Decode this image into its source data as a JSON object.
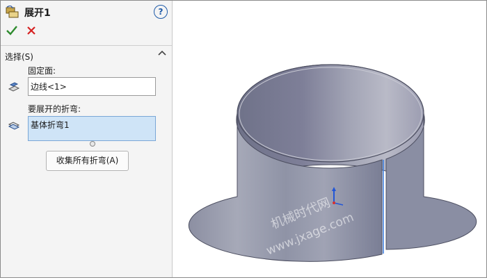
{
  "panel": {
    "title": "展开1",
    "help_icon": "help-icon",
    "help_glyph": "?",
    "group": {
      "label": "选择(S)",
      "fixed_face_label": "固定面:",
      "fixed_face_value": "边线<1>",
      "bends_label": "要展开的折弯:",
      "bends_value": "基体折弯1",
      "collect_button": "收集所有折弯(A)"
    }
  },
  "viewport": {
    "watermark_line1": "机械时代网",
    "watermark_line2": "www.jxage.com"
  },
  "colors": {
    "ok_green": "#2e8b2e",
    "cancel_red": "#d62222",
    "selection_blue": "#cfe4f7",
    "part_gray": "#8a8fa8"
  }
}
